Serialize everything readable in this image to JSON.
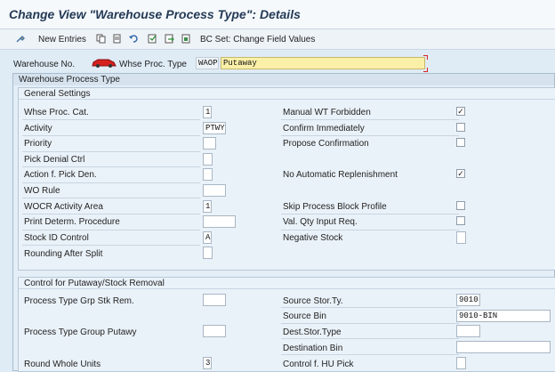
{
  "title": "Change View \"Warehouse Process Type\": Details",
  "toolbar": {
    "new_entries": "New Entries",
    "bc_set": "BC Set: Change Field Values"
  },
  "header": {
    "warehouse_label": "Warehouse No.",
    "whse_proc_type_label": "Whse Proc. Type",
    "whse_proc_type_value": "WAOP",
    "description_value": "Putaway"
  },
  "panel": {
    "title": "Warehouse Process Type",
    "general": {
      "title": "General Settings",
      "left": [
        {
          "label": "Whse Proc. Cat.",
          "value": "1"
        },
        {
          "label": "Activity",
          "value": "PTWY"
        },
        {
          "label": "Priority",
          "value": ""
        },
        {
          "label": "Pick Denial Ctrl",
          "value": ""
        },
        {
          "label": "Action f. Pick Den.",
          "value": ""
        },
        {
          "label": "WO Rule",
          "value": ""
        },
        {
          "label": "WOCR Activity Area",
          "value": "1"
        },
        {
          "label": "Print Determ. Procedure",
          "value": ""
        },
        {
          "label": "Stock ID Control",
          "value": "A"
        },
        {
          "label": "Rounding After Split",
          "value": ""
        }
      ],
      "right": [
        {
          "label": "Manual WT Forbidden",
          "checked": true
        },
        {
          "label": "Confirm Immediately",
          "checked": false
        },
        {
          "label": "Propose Confirmation",
          "checked": false
        },
        {
          "label": "No Automatic Replenishment",
          "checked": true
        },
        {
          "label": "Skip Process Block Profile",
          "checked": false
        },
        {
          "label": "Val. Qty Input Req.",
          "checked": false
        },
        {
          "label": "Negative Stock",
          "checked": false
        }
      ]
    },
    "control": {
      "title": "Control for Putaway/Stock Removal",
      "left": [
        {
          "label": "Process Type Grp Stk Rem.",
          "value": ""
        },
        {
          "label": "Process Type Group Putawy",
          "value": ""
        },
        {
          "label": "Round Whole Units",
          "value": "3"
        }
      ],
      "right": [
        {
          "label": "Source Stor.Ty.",
          "value": "9010"
        },
        {
          "label": "Source Bin",
          "value": "9010-BIN"
        },
        {
          "label": "Dest.Stor.Type",
          "value": ""
        },
        {
          "label": "Destination Bin",
          "value": ""
        },
        {
          "label": "Control f. HU Pick",
          "value": ""
        }
      ]
    }
  }
}
